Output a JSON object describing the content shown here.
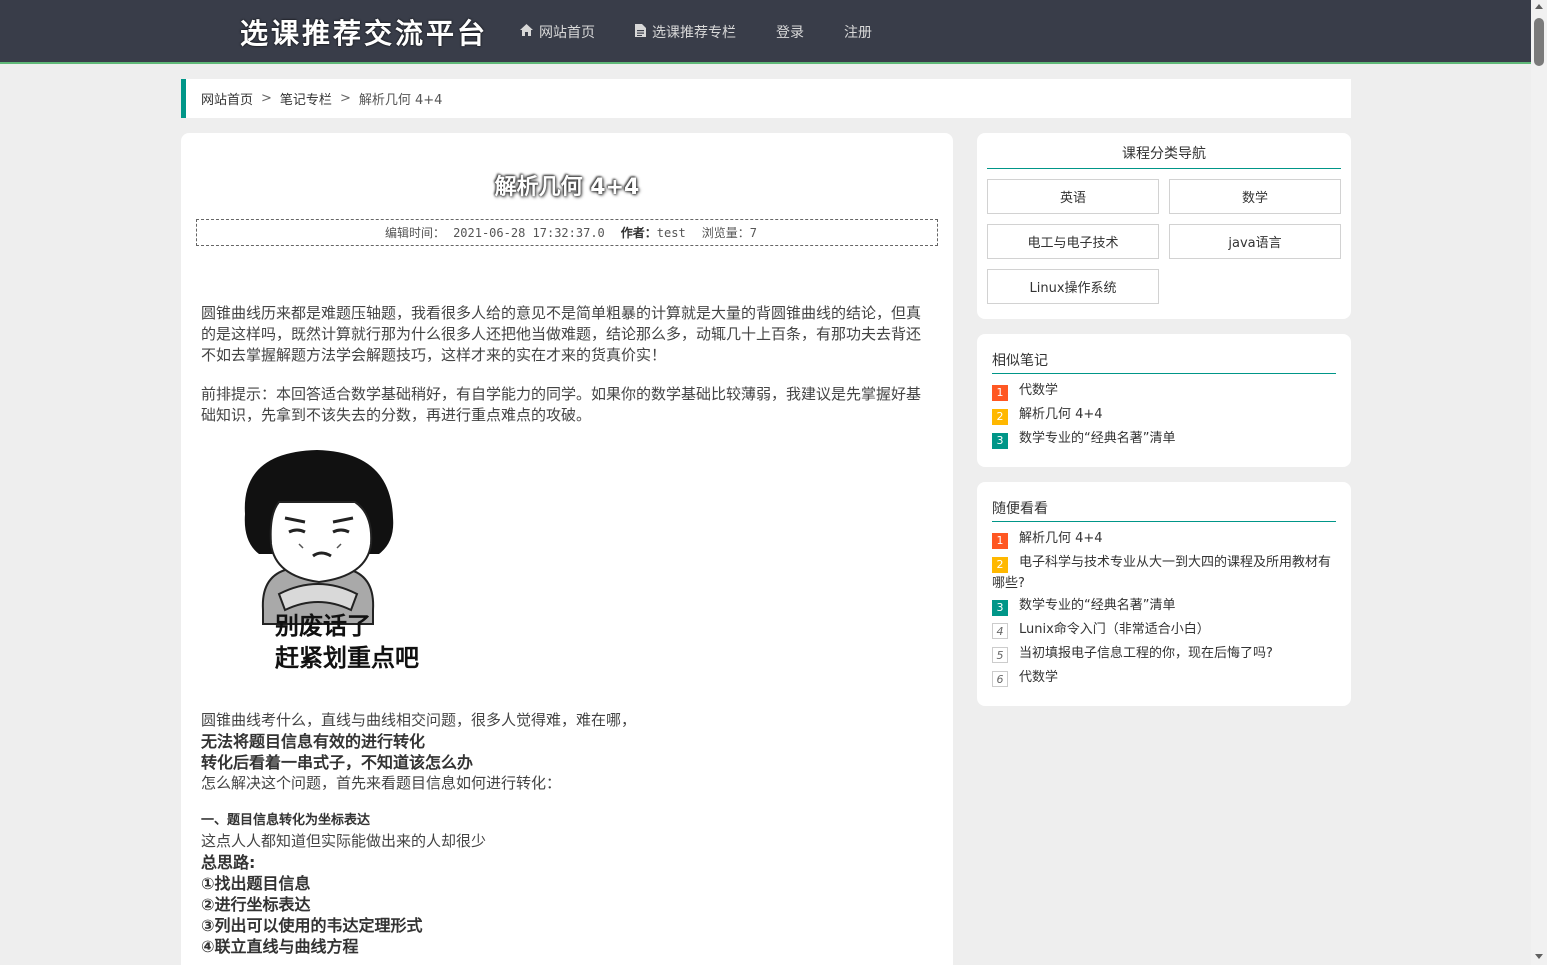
{
  "header": {
    "logo": "选课推荐交流平台",
    "nav": [
      {
        "label": "网站首页",
        "icon": "home-icon"
      },
      {
        "label": "选课推荐专栏",
        "icon": "document-icon"
      },
      {
        "label": "登录"
      },
      {
        "label": "注册"
      }
    ]
  },
  "breadcrumb": {
    "items": [
      "网站首页",
      "笔记专栏",
      "解析几何 4+4"
    ],
    "separator": ">"
  },
  "article": {
    "title": "解析几何 4+4",
    "edit_time_label": "编辑时间：",
    "edit_time": "2021-06-28 17:32:37.0",
    "author_label": "作者：",
    "author": "test",
    "views_label": "浏览量：",
    "views": "7",
    "paragraphs": [
      "圆锥曲线历来都是难题压轴题，我看很多人给的意见不是简单粗暴的计算就是大量的背圆锥曲线的结论，但真的是这样吗，既然计算就行那为什么很多人还把他当做难题，结论那么多，动辄几十上百条，有那功夫去背还不如去掌握解题方法学会解题技巧，这样才来的实在才来的货真价实！",
      "前排提示：本回答适合数学基础稍好，有自学能力的同学。如果你的数学基础比较薄弱，我建议是先掌握好基础知识，先拿到不该失去的分数，再进行重点难点的攻破。"
    ],
    "meme": {
      "caption_line1": "别废话了",
      "caption_line2": "赶紧划重点吧"
    },
    "after_meme": {
      "line1": "圆锥曲线考什么，直线与曲线相交问题，很多人觉得难，难在哪，",
      "bold1": "无法将题目信息有效的进行转化",
      "bold2": "转化后看着一串式子，不知道该怎么办",
      "line2": "怎么解决这个问题，首先来看题目信息如何进行转化："
    },
    "section1": {
      "heading": "一、题目信息转化为坐标表达",
      "line": "这点人人都知道但实际能做出来的人却很少",
      "summary_label": "总思路:",
      "steps": [
        "①找出题目信息",
        "②进行坐标表达",
        "③列出可以使用的韦达定理形式",
        "④联立直线与曲线方程"
      ]
    }
  },
  "category_nav": {
    "title": "课程分类导航",
    "items": [
      "英语",
      "数学",
      "电工与电子技术",
      "java语言",
      "Linux操作系统"
    ]
  },
  "similar_notes": {
    "title": "相似笔记",
    "items": [
      {
        "rank": "1",
        "text": "代数学"
      },
      {
        "rank": "2",
        "text": "解析几何 4+4"
      },
      {
        "rank": "3",
        "text": "数学专业的“经典名著”清单"
      }
    ]
  },
  "random_notes": {
    "title": "随便看看",
    "items": [
      {
        "rank": "1",
        "text": "解析几何 4+4"
      },
      {
        "rank": "2",
        "text": "电子科学与技术专业从大一到大四的课程及所用教材有哪些?"
      },
      {
        "rank": "3",
        "text": "数学专业的“经典名著”清单"
      },
      {
        "rank": "4",
        "text": "Lunix命令入门（非常适合小白）"
      },
      {
        "rank": "5",
        "text": "当初填报电子信息工程的你，现在后悔了吗?"
      },
      {
        "rank": "6",
        "text": "代数学"
      }
    ]
  },
  "colors": {
    "header_bg": "#393d49",
    "accent": "#009688",
    "rank1": "#ff5722",
    "rank2": "#ffb800",
    "rank3": "#009688"
  }
}
